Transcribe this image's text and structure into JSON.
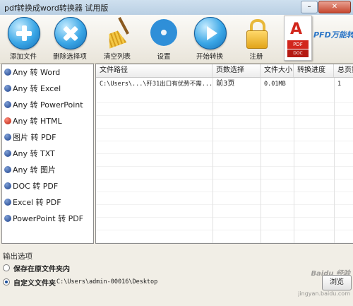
{
  "window": {
    "title": "pdf转换成word转换器 试用版"
  },
  "toolbar": {
    "buttons": [
      {
        "label": "添加文件",
        "icon": "add-icon"
      },
      {
        "label": "删除选择项",
        "icon": "delete-icon"
      },
      {
        "label": "清空列表",
        "icon": "broom-icon"
      },
      {
        "label": "设置",
        "icon": "gear-icon"
      },
      {
        "label": "开始转换",
        "icon": "play-icon"
      },
      {
        "label": "注册",
        "icon": "lock-icon"
      }
    ],
    "brand": "PFD万能转",
    "logo_a": "A",
    "logo_tag1": "PDF",
    "logo_tag2": "DOC"
  },
  "sidebar": {
    "items": [
      {
        "label": "Any 转 Word",
        "color": "#1b3f8a"
      },
      {
        "label": "Any 转 Excel",
        "color": "#1b3f8a"
      },
      {
        "label": "Any 转 PowerPoint",
        "color": "#1b3f8a"
      },
      {
        "label": "Any 转 HTML",
        "color": "#b51d0b"
      },
      {
        "label": "图片 转 PDF",
        "color": "#1b3f8a"
      },
      {
        "label": "Any 转 TXT",
        "color": "#1b3f8a"
      },
      {
        "label": "Any 转 图片",
        "color": "#1b3f8a"
      },
      {
        "label": "DOC 转 PDF",
        "color": "#1b3f8a"
      },
      {
        "label": "Excel 转 PDF",
        "color": "#1b3f8a"
      },
      {
        "label": "PowerPoint 转 PDF",
        "color": "#1b3f8a"
      }
    ]
  },
  "table": {
    "columns": [
      "文件路径",
      "页数选择",
      "文件大小",
      "转换进度",
      "总页数"
    ],
    "rows": [
      [
        "C:\\Users\\...\\歼31出口有优势不需...",
        "前3页",
        "0.01MB",
        "",
        "1"
      ]
    ]
  },
  "output": {
    "section_label": "输出选项",
    "option_original": "保存在原文件夹内",
    "option_custom": "自定义文件夹",
    "custom_path": "C:\\Users\\admin-00016\\Desktop",
    "browse_label": "浏览"
  },
  "watermark": {
    "line1": "Baidu 经验",
    "line2": "jingyan.baidu.com"
  }
}
